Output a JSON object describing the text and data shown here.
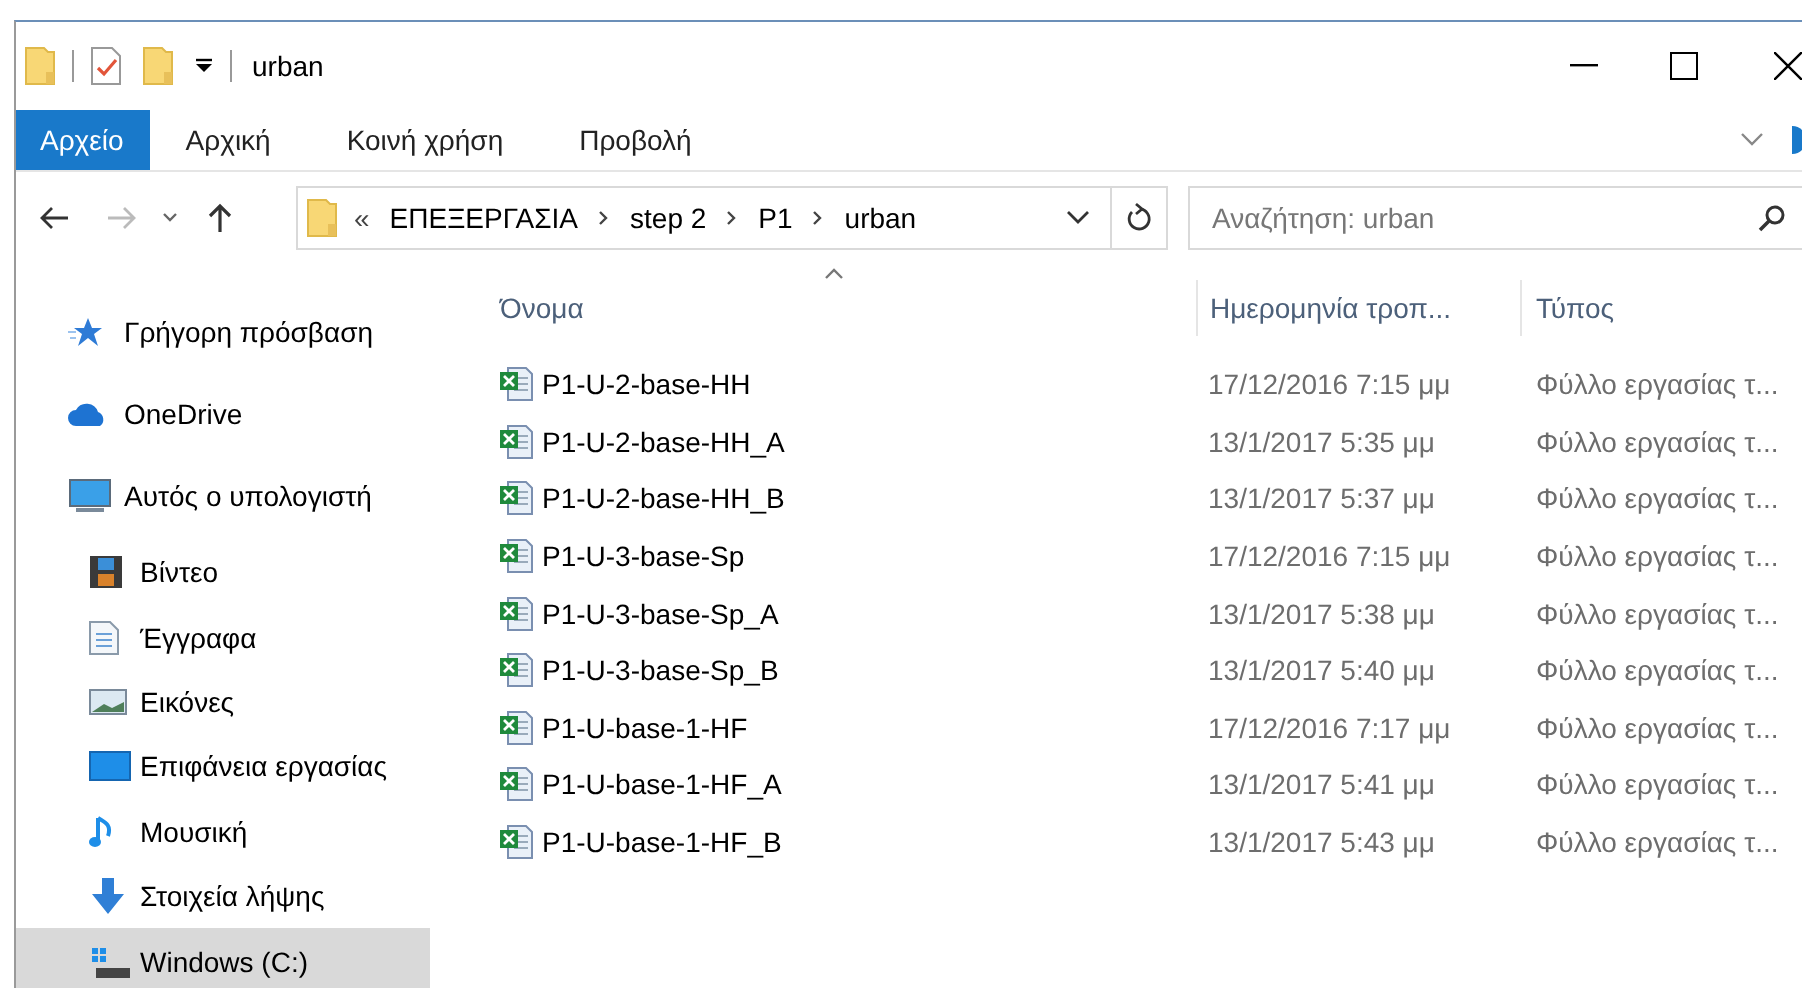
{
  "window": {
    "title": "urban"
  },
  "ribbon": {
    "tabs": [
      {
        "label": "Αρχείο",
        "selected": true
      },
      {
        "label": "Αρχική",
        "selected": false
      },
      {
        "label": "Κοινή χρήση",
        "selected": false
      },
      {
        "label": "Προβολή",
        "selected": false
      }
    ]
  },
  "address_bar": {
    "overflow": "«",
    "path": [
      "ΕΠΕΞΕΡΓΑΣΙΑ",
      "step 2",
      "P1",
      "urban"
    ]
  },
  "search": {
    "placeholder": "Αναζήτηση: urban"
  },
  "sidebar": {
    "items": [
      {
        "label": "Γρήγορη πρόσβαση",
        "kind": "star",
        "selected": false
      },
      {
        "label": "OneDrive",
        "kind": "cloud",
        "selected": false
      },
      {
        "label": "Αυτός ο υπολογιστή",
        "kind": "computer",
        "selected": false,
        "children": [
          {
            "label": "Βίντεο",
            "kind": "video",
            "selected": false
          },
          {
            "label": "Έγγραφα",
            "kind": "document",
            "selected": false
          },
          {
            "label": "Εικόνες",
            "kind": "picture",
            "selected": false
          },
          {
            "label": "Επιφάνεια εργασίας",
            "kind": "desktop",
            "selected": false
          },
          {
            "label": "Μουσική",
            "kind": "music",
            "selected": false
          },
          {
            "label": "Στοιχεία λήψης",
            "kind": "download",
            "selected": false
          },
          {
            "label": "Windows (C:)",
            "kind": "drive",
            "selected": true
          }
        ]
      }
    ]
  },
  "table": {
    "columns": [
      "Όνομα",
      "Ημερομηνία τροπ...",
      "Τύπος"
    ],
    "rows": [
      {
        "name": "P1-U-2-base-HH",
        "date": "17/12/2016 7:15 μμ",
        "type": "Φύλλο εργασίας τ...",
        "selected": false
      },
      {
        "name": "P1-U-2-base-HH_A",
        "date": "13/1/2017 5:35 μμ",
        "type": "Φύλλο εργασίας τ...",
        "selected": false
      },
      {
        "name": "P1-U-2-base-HH_B",
        "date": "13/1/2017 5:37 μμ",
        "type": "Φύλλο εργασίας τ...",
        "selected": false
      },
      {
        "name": "P1-U-3-base-Sp",
        "date": "17/12/2016 7:15 μμ",
        "type": "Φύλλο εργασίας τ...",
        "selected": false
      },
      {
        "name": "P1-U-3-base-Sp_A",
        "date": "13/1/2017 5:38 μμ",
        "type": "Φύλλο εργασίας τ...",
        "selected": false
      },
      {
        "name": "P1-U-3-base-Sp_B",
        "date": "13/1/2017 5:40 μμ",
        "type": "Φύλλο εργασίας τ...",
        "selected": false
      },
      {
        "name": "P1-U-base-1-HF",
        "date": "17/12/2016 7:17 μμ",
        "type": "Φύλλο εργασίας τ...",
        "selected": false
      },
      {
        "name": "P1-U-base-1-HF_A",
        "date": "13/1/2017 5:41 μμ",
        "type": "Φύλλο εργασίας τ...",
        "selected": false
      },
      {
        "name": "P1-U-base-1-HF_B",
        "date": "13/1/2017 5:43 μμ",
        "type": "Φύλλο εργασίας τ...",
        "selected": false
      }
    ]
  }
}
